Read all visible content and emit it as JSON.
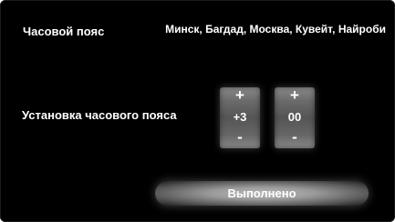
{
  "timezone": {
    "label": "Часовой пояс",
    "value": "Минск, Багдад, Москва, Кувейт, Найроби"
  },
  "timezone_setting": {
    "label": "Установка часового пояса",
    "hours": {
      "increment_label": "+",
      "value": "+3",
      "decrement_label": "-"
    },
    "minutes": {
      "increment_label": "+",
      "value": "00",
      "decrement_label": "-"
    }
  },
  "done_button": {
    "label": "Выполнено"
  }
}
